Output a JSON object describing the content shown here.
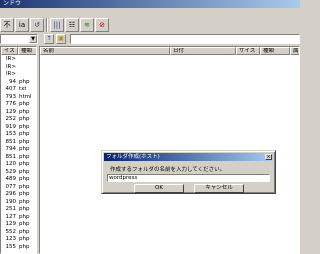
{
  "window": {
    "title": "ンドウ"
  },
  "toolbar": {
    "buttons": [
      {
        "label": "不",
        "icon": "text-button-icon"
      },
      {
        "label": "ia",
        "icon": "view-icon"
      },
      {
        "label": "↺",
        "icon": "refresh-icon"
      },
      {
        "label": "|||",
        "icon": "columns-icon"
      },
      {
        "label": "☷",
        "icon": "list-icon"
      },
      {
        "label": "≋",
        "icon": "transfer-icon"
      },
      {
        "label": "⊘",
        "icon": "stop-icon"
      }
    ]
  },
  "address": {
    "folder_up": "↑",
    "new_folder": "▣",
    "path": ""
  },
  "local_pane": {
    "headers": {
      "size": "イズ",
      "type": "種類"
    },
    "rows": [
      {
        "size": "IR>",
        "type": ""
      },
      {
        "size": "IR>",
        "type": ""
      },
      {
        "size": "IR>",
        "type": ""
      },
      {
        "size": "94",
        "type": "php"
      },
      {
        "size": "407",
        "type": "txt"
      },
      {
        "size": "793",
        "type": "html"
      },
      {
        "size": "776",
        "type": "php"
      },
      {
        "size": "129",
        "type": "php"
      },
      {
        "size": "252",
        "type": "php"
      },
      {
        "size": "919",
        "type": "php"
      },
      {
        "size": "153",
        "type": "php"
      },
      {
        "size": "851",
        "type": "php"
      },
      {
        "size": "794",
        "type": "php"
      },
      {
        "size": "851",
        "type": "php"
      },
      {
        "size": "120",
        "type": "php"
      },
      {
        "size": "529",
        "type": "php"
      },
      {
        "size": "489",
        "type": "php"
      },
      {
        "size": "077",
        "type": "php"
      },
      {
        "size": "296",
        "type": "php"
      },
      {
        "size": "190",
        "type": "php"
      },
      {
        "size": "251",
        "type": "php"
      },
      {
        "size": "127",
        "type": "php"
      },
      {
        "size": "129",
        "type": "php"
      },
      {
        "size": "552",
        "type": "php"
      },
      {
        "size": "123",
        "type": "php"
      },
      {
        "size": "155",
        "type": "php"
      }
    ]
  },
  "remote_pane": {
    "headers": {
      "name": "名前",
      "date": "日付",
      "size": "サイズ",
      "type": "種類",
      "attr": "属"
    }
  },
  "dialog": {
    "title": "フォルダ作成(ホスト)",
    "close": "×",
    "prompt": "作成するフォルダの名前を入力してください。",
    "input_value": "wordpress",
    "ok": "OK",
    "cancel": "キャンセル"
  }
}
